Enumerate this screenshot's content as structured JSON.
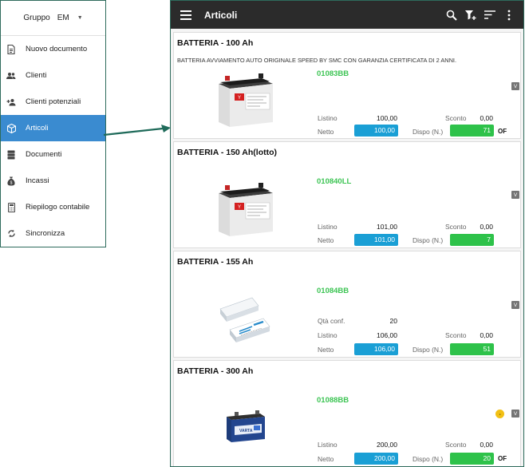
{
  "drawer": {
    "group_label": "Gruppo",
    "group_value": "EM",
    "items": [
      {
        "label": "Nuovo documento",
        "icon": "document-icon"
      },
      {
        "label": "Clienti",
        "icon": "people-icon"
      },
      {
        "label": "Clienti potenziali",
        "icon": "person-add-icon"
      },
      {
        "label": "Articoli",
        "icon": "cube-icon",
        "active": true
      },
      {
        "label": "Documenti",
        "icon": "storage-icon"
      },
      {
        "label": "Incassi",
        "icon": "money-bag-icon"
      },
      {
        "label": "Riepilogo contabile",
        "icon": "calculator-icon"
      },
      {
        "label": "Sincronizza",
        "icon": "sync-icon"
      }
    ]
  },
  "appbar": {
    "title": "Articoli",
    "actions": [
      "search-icon",
      "add-filter-icon",
      "sort-icon",
      "more-vert-icon"
    ]
  },
  "labels": {
    "listino": "Listino",
    "netto": "Netto",
    "sconto": "Sconto",
    "dispo": "Dispo (N.)",
    "qta_conf": "Qtà conf.",
    "v_badge": "V"
  },
  "colors": {
    "code_green": "#3cc453",
    "netto_blue": "#1a9fd5",
    "dispo_green": "#2ec24a",
    "active_nav": "#3a8bd0",
    "appbar_bg": "#2b2b2b"
  },
  "articles": [
    {
      "name": "BATTERIA - 100 Ah",
      "description": "BATTERIA AVVIAMENTO AUTO ORIGINALE SPEED BY SMC CON GARANZIA CERTIFICATA DI 2 ANNI.",
      "code": "01083BB",
      "listino": "100,00",
      "sconto": "0,00",
      "netto": "100,00",
      "dispo": "71",
      "of": "OF",
      "image": "ups-battery-image"
    },
    {
      "name": "BATTERIA - 150 Ah(lotto)",
      "code": "010840LL",
      "listino": "101,00",
      "sconto": "0,00",
      "netto": "101,00",
      "dispo": "7",
      "image": "ups-battery-image"
    },
    {
      "name": "BATTERIA - 155 Ah",
      "code": "01084BB",
      "qta_conf": "20",
      "listino": "106,00",
      "sconto": "0,00",
      "netto": "106,00",
      "dispo": "51",
      "image": "phone-battery-image"
    },
    {
      "name": "BATTERIA - 300 Ah",
      "code": "01088BB",
      "listino": "200,00",
      "sconto": "0,00",
      "netto": "200,00",
      "dispo": "20",
      "of": "OF",
      "image": "car-battery-image",
      "coin_icon": "coin-icon"
    }
  ]
}
